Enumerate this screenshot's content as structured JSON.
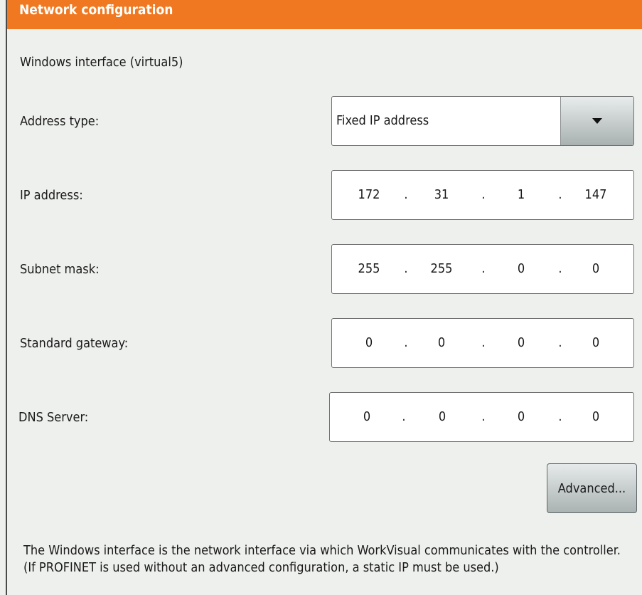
{
  "title": "Network configuration",
  "interface_label": "Windows interface (virtual5)",
  "address_type": {
    "label": "Address type:",
    "value": "Fixed IP address"
  },
  "ip_address": {
    "label": "IP address:",
    "octets": [
      "172",
      "31",
      "1",
      "147"
    ]
  },
  "subnet_mask": {
    "label": "Subnet mask:",
    "octets": [
      "255",
      "255",
      "0",
      "0"
    ]
  },
  "standard_gateway": {
    "label": "Standard gateway:",
    "octets": [
      "0",
      "0",
      "0",
      "0"
    ]
  },
  "dns_server": {
    "label": "DNS Server:",
    "octets": [
      "0",
      "0",
      "0",
      "0"
    ]
  },
  "separator": ".",
  "advanced_button": "Advanced...",
  "info_text": "The Windows interface is the network interface via which WorkVisual communicates with the controller. (If PROFINET is used without an advanced configuration, a static IP must be used.)",
  "colors": {
    "title_bar": "#f07820",
    "background": "#eef0ed"
  },
  "icons": {
    "dropdown": "triangle-down-icon"
  }
}
